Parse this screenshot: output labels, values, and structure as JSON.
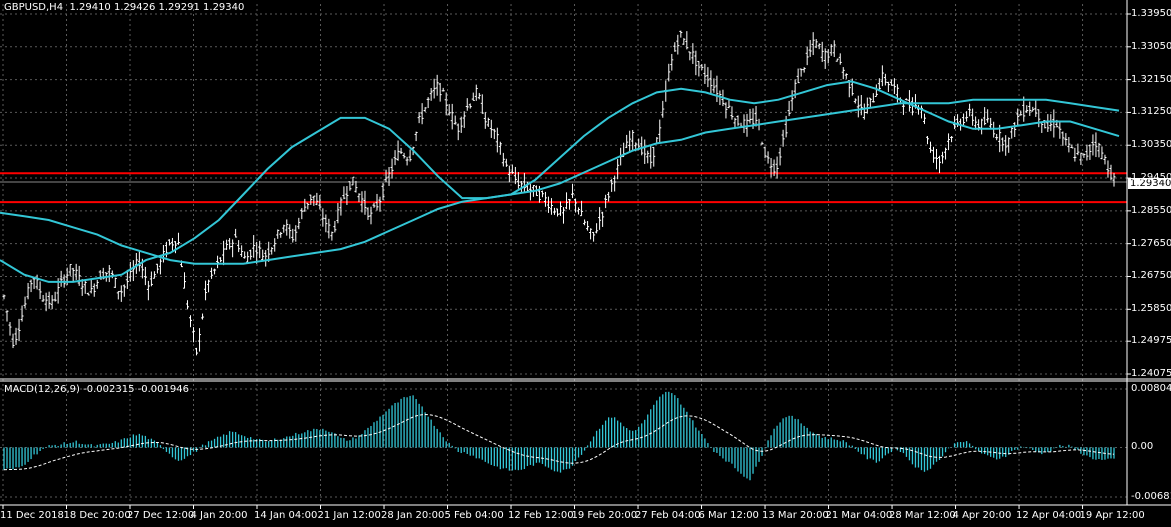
{
  "header": {
    "symbol": "GBPUSD,H4",
    "ohlc": "1.29410 1.29426 1.29291 1.29340"
  },
  "macd_header": {
    "label": "MACD(12,26,9) -0.002315 -0.001946"
  },
  "current_price_tag": "1.29340",
  "colors": {
    "background": "#000000",
    "grid": "#5a5a5a",
    "bars": "#ffffff",
    "moving_average": "#33c6d6",
    "support_resistance": "#ff0000",
    "macd_histogram": "#33c6d6",
    "macd_signal": "#ffffff"
  },
  "chart_data": [
    {
      "type": "bar",
      "name": "price",
      "y_ticks": [
        "1.33950",
        "1.33050",
        "1.32150",
        "1.31250",
        "1.30350",
        "1.29450",
        "1.28550",
        "1.27650",
        "1.26750",
        "1.25850",
        "1.24975",
        "1.24075"
      ],
      "ylim": [
        1.24075,
        1.3395
      ],
      "x_ticks": [
        "11 Dec 2018",
        "18 Dec 20:00",
        "27 Dec 12:00",
        "4 Jan 20:00",
        "14 Jan 04:00",
        "21 Jan 12:00",
        "28 Jan 20:00",
        "5 Feb 04:00",
        "12 Feb 12:00",
        "19 Feb 20:00",
        "27 Feb 04:00",
        "6 Mar 12:00",
        "13 Mar 20:00",
        "21 Mar 04:00",
        "28 Mar 12:00",
        "4 Apr 20:00",
        "12 Apr 04:00",
        "19 Apr 12:00"
      ],
      "price_path": [
        1.262,
        1.249,
        1.258,
        1.268,
        1.262,
        1.26,
        1.266,
        1.27,
        1.266,
        1.263,
        1.268,
        1.269,
        1.263,
        1.267,
        1.272,
        1.265,
        1.27,
        1.276,
        1.278,
        1.26,
        1.246,
        1.265,
        1.27,
        1.275,
        1.278,
        1.272,
        1.276,
        1.273,
        1.277,
        1.282,
        1.278,
        1.286,
        1.29,
        1.284,
        1.279,
        1.288,
        1.294,
        1.289,
        1.284,
        1.289,
        1.296,
        1.302,
        1.3,
        1.31,
        1.316,
        1.32,
        1.314,
        1.308,
        1.314,
        1.318,
        1.31,
        1.306,
        1.298,
        1.294,
        1.292,
        1.291,
        1.289,
        1.286,
        1.285,
        1.29,
        1.283,
        1.278,
        1.285,
        1.293,
        1.3,
        1.306,
        1.303,
        1.299,
        1.308,
        1.325,
        1.334,
        1.33,
        1.325,
        1.322,
        1.318,
        1.314,
        1.31,
        1.309,
        1.311,
        1.3,
        1.297,
        1.308,
        1.32,
        1.326,
        1.332,
        1.328,
        1.33,
        1.324,
        1.318,
        1.312,
        1.316,
        1.322,
        1.32,
        1.316,
        1.314,
        1.315,
        1.302,
        1.299,
        1.306,
        1.31,
        1.312,
        1.309,
        1.31,
        1.306,
        1.304,
        1.311,
        1.314,
        1.313,
        1.308,
        1.31,
        1.304,
        1.301,
        1.3,
        1.305,
        1.3,
        1.294
      ],
      "moving_averages": [
        {
          "values": [
            1.272,
            1.268,
            1.266,
            1.266,
            1.267,
            1.268,
            1.272,
            1.274,
            1.278,
            1.283,
            1.29,
            1.297,
            1.303,
            1.307,
            1.311,
            1.311,
            1.308,
            1.302,
            1.295,
            1.289,
            1.289,
            1.29,
            1.294,
            1.3,
            1.306,
            1.311,
            1.315,
            1.318,
            1.319,
            1.318,
            1.316,
            1.315,
            1.316,
            1.318,
            1.32,
            1.321,
            1.319,
            1.316,
            1.313,
            1.31,
            1.308,
            1.308,
            1.309,
            1.31,
            1.31,
            1.308,
            1.306
          ]
        },
        {
          "values": [
            1.285,
            1.284,
            1.283,
            1.281,
            1.279,
            1.276,
            1.274,
            1.272,
            1.271,
            1.271,
            1.271,
            1.272,
            1.273,
            1.274,
            1.275,
            1.277,
            1.28,
            1.283,
            1.286,
            1.288,
            1.289,
            1.29,
            1.291,
            1.293,
            1.296,
            1.299,
            1.302,
            1.304,
            1.305,
            1.307,
            1.308,
            1.309,
            1.31,
            1.311,
            1.312,
            1.313,
            1.314,
            1.315,
            1.315,
            1.315,
            1.316,
            1.316,
            1.316,
            1.316,
            1.315,
            1.314,
            1.313
          ]
        }
      ],
      "horizontal_lines": [
        1.2958,
        1.2879
      ]
    },
    {
      "type": "bar",
      "name": "MACD(12,26,9)",
      "y_ticks": [
        "0.008047",
        "0.00",
        "-0.006819"
      ],
      "ylim": [
        -0.006819,
        0.008047
      ],
      "histogram": [
        -0.003,
        -0.003,
        -0.0026,
        -0.0014,
        -0.0004,
        0.0002,
        0.0004,
        0.0006,
        0.0008,
        0.0004,
        0.0002,
        0.0004,
        0.0006,
        0.001,
        0.0016,
        0.0018,
        0.0012,
        0.0004,
        -0.0006,
        -0.0018,
        -0.0014,
        -0.0006,
        0.0004,
        0.001,
        0.0016,
        0.0022,
        0.0018,
        0.0014,
        0.001,
        0.0008,
        0.0012,
        0.0014,
        0.0018,
        0.0022,
        0.0024,
        0.0026,
        0.0022,
        0.0012,
        0.001,
        0.0016,
        0.0026,
        0.0038,
        0.005,
        0.006,
        0.0068,
        0.007,
        0.0056,
        0.0036,
        0.002,
        0.0004,
        -0.0006,
        -0.0008,
        -0.0014,
        -0.002,
        -0.0026,
        -0.003,
        -0.0032,
        -0.003,
        -0.0024,
        -0.0022,
        -0.0028,
        -0.0034,
        -0.003,
        -0.0016,
        0.0,
        0.002,
        0.0036,
        0.0044,
        0.003,
        0.0022,
        0.003,
        0.005,
        0.0068,
        0.0078,
        0.0068,
        0.005,
        0.003,
        0.0012,
        -0.0004,
        -0.0014,
        -0.0024,
        -0.0036,
        -0.0044,
        -0.002,
        0.0012,
        0.0032,
        0.0044,
        0.004,
        0.003,
        0.002,
        0.0014,
        0.0012,
        0.001,
        0.0004,
        -0.0006,
        -0.0016,
        -0.002,
        -0.001,
        0.0,
        -0.001,
        -0.0024,
        -0.0034,
        -0.0026,
        -0.0014,
        0.0,
        0.001,
        0.0006,
        -0.0004,
        -0.0012,
        -0.0016,
        -0.0012,
        -0.0004,
        0.0002,
        -0.0004,
        -0.0008,
        -0.0004,
        0.0002,
        0.0002,
        -0.0004,
        -0.0012,
        -0.0016,
        -0.0018,
        -0.0016
      ]
    }
  ]
}
